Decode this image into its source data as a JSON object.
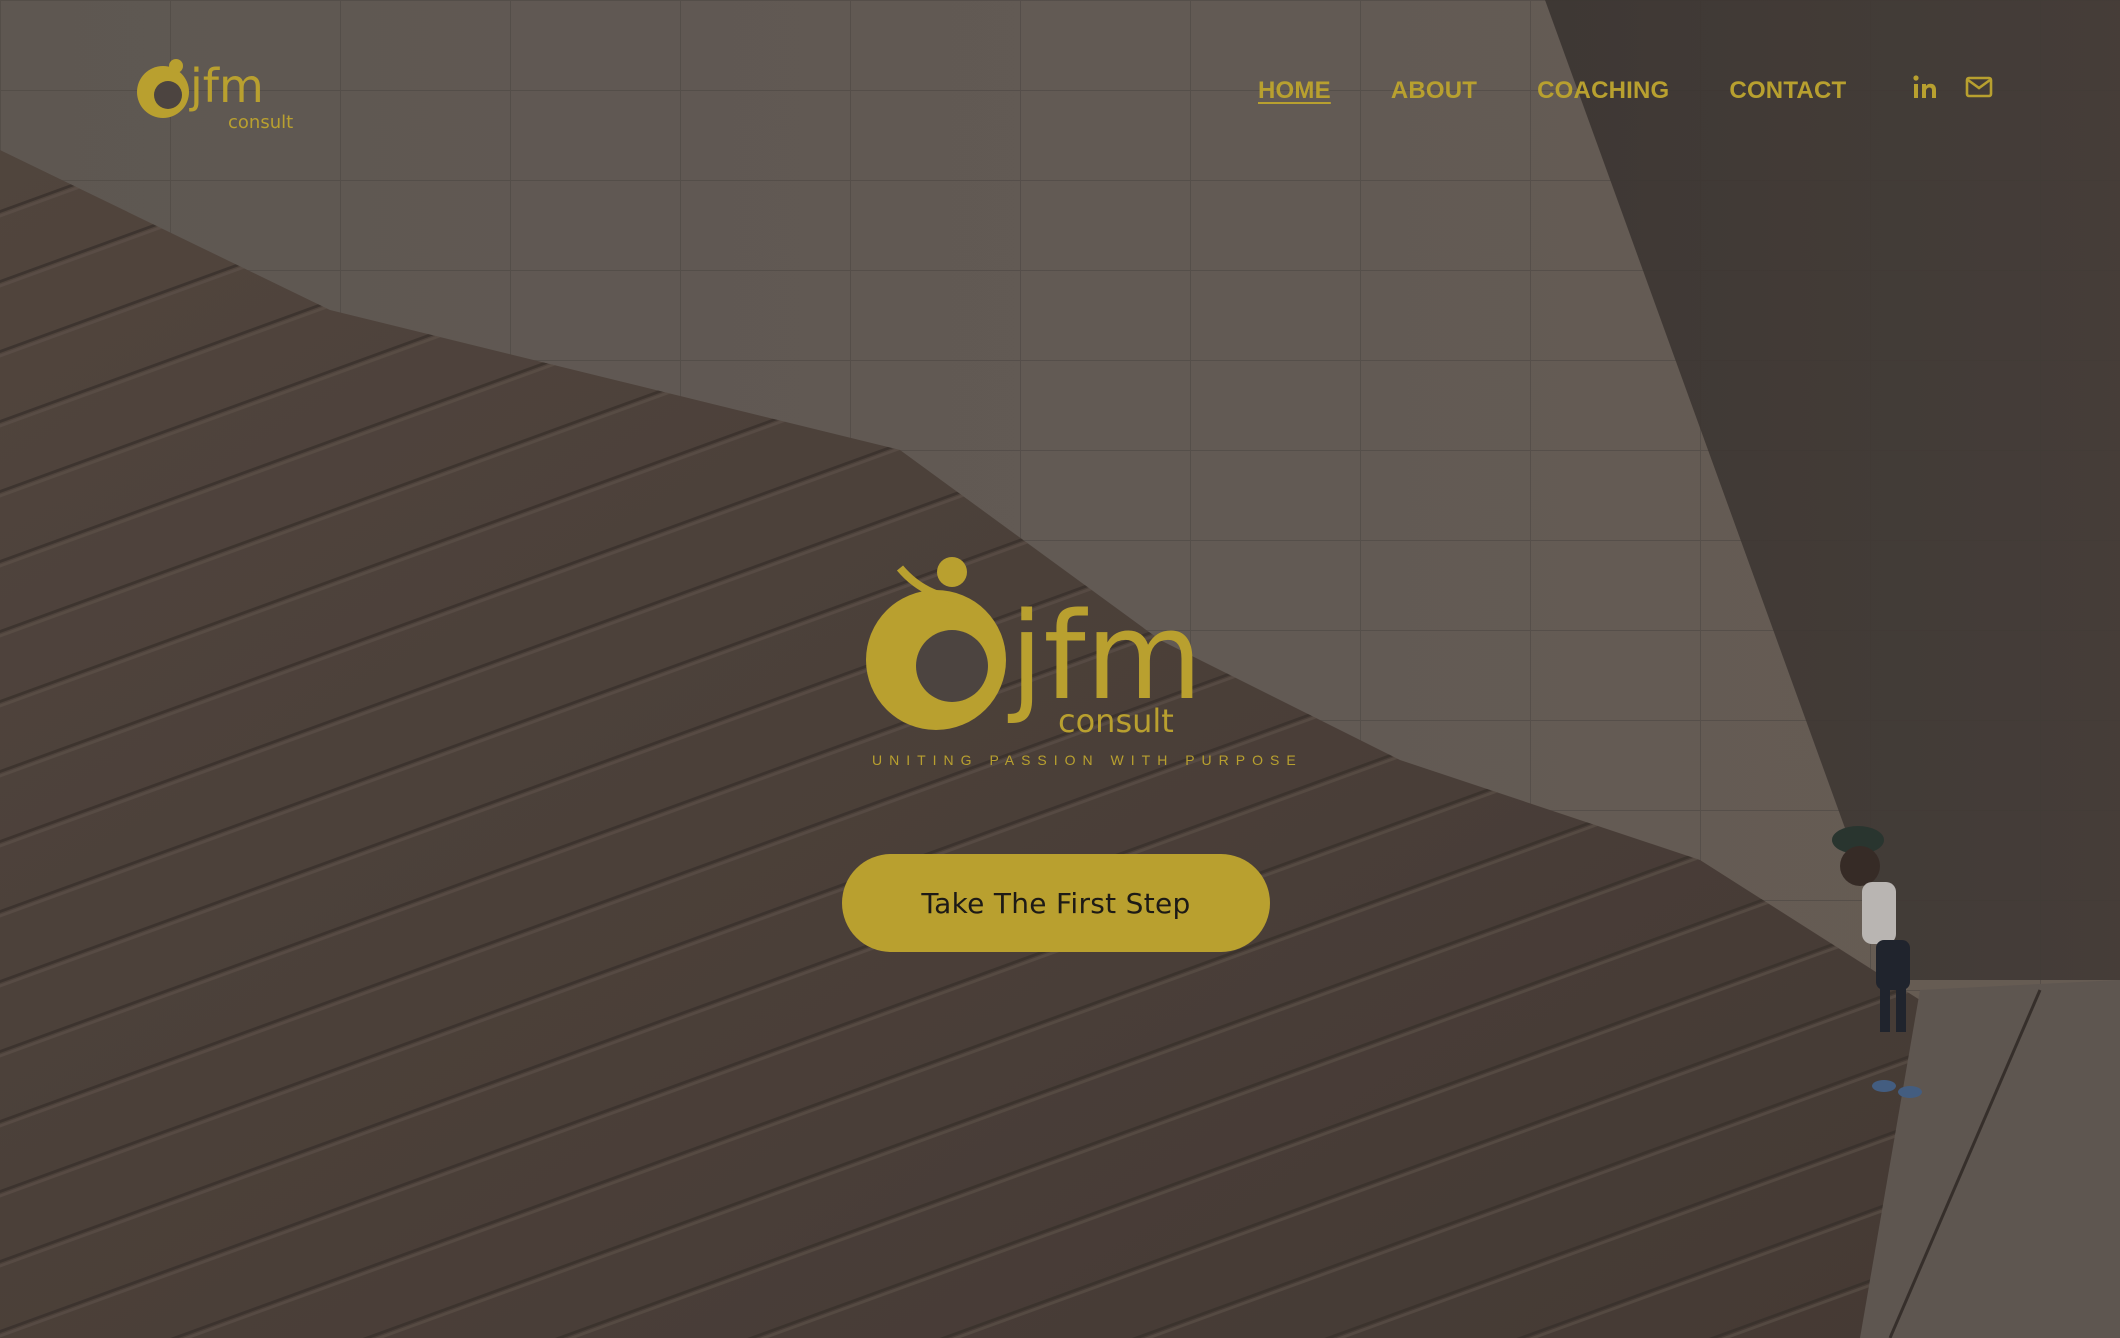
{
  "brand": {
    "logo_wordmark": "jfm",
    "logo_subword": "consult",
    "tagline": "UNITING PASSION WITH PURPOSE",
    "gold": "#b8a02f"
  },
  "nav": {
    "items": [
      {
        "label": "HOME",
        "active": true
      },
      {
        "label": "ABOUT",
        "active": false
      },
      {
        "label": "COACHING",
        "active": false
      },
      {
        "label": "CONTACT",
        "active": false
      }
    ]
  },
  "social": {
    "icons": [
      "linkedin-icon",
      "mail-icon"
    ]
  },
  "hero": {
    "cta_label": "Take The First Step"
  }
}
